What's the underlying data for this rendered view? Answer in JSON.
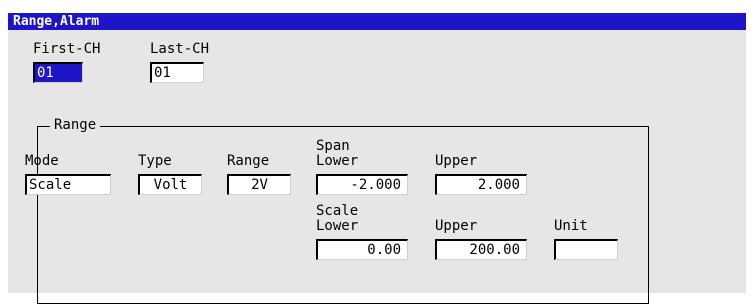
{
  "window": {
    "title": "Range,Alarm",
    "title_color": "#1e14c8",
    "panel_color": "#e6e6e6"
  },
  "channels": {
    "first_label": "First-CH",
    "first_value": "01",
    "last_label": "Last-CH",
    "last_value": "01"
  },
  "range_group": {
    "legend": "Range",
    "mode_label": "Mode",
    "mode_value": "Scale",
    "type_label": "Type",
    "type_value": "Volt",
    "range_label": "Range",
    "range_value": "2V",
    "span_label": "Span",
    "span_lower_label": "Lower",
    "span_lower_value": "-2.000",
    "span_upper_label": "Upper",
    "span_upper_value": "2.000",
    "scale_label": "Scale",
    "scale_lower_label": "Lower",
    "scale_lower_value": "0.00",
    "scale_upper_label": "Upper",
    "scale_upper_value": "200.00",
    "unit_label": "Unit",
    "unit_value": ""
  }
}
